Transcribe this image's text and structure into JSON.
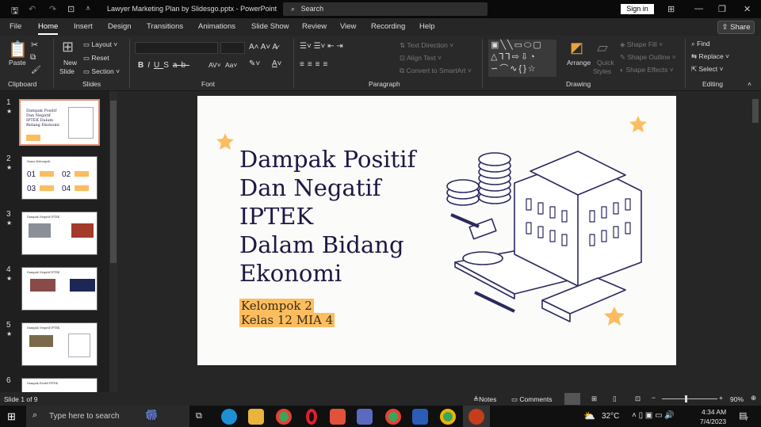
{
  "window": {
    "title": "Lawyer Marketing Plan by Slidesgo.pptx  -  PowerPoint",
    "search": "Search",
    "sign_in": "Sign in"
  },
  "tabs": [
    "File",
    "Home",
    "Insert",
    "Design",
    "Transitions",
    "Animations",
    "Slide Show",
    "Review",
    "View",
    "Recording",
    "Help"
  ],
  "share": "Share",
  "ribbon": {
    "clipboard": {
      "label": "Clipboard",
      "paste": "Paste"
    },
    "slides": {
      "label": "Slides",
      "new_slide_1": "New",
      "new_slide_2": "Slide",
      "layout": "Layout",
      "reset": "Reset",
      "section": "Section"
    },
    "font": {
      "label": "Font"
    },
    "paragraph": {
      "label": "Paragraph",
      "text_direction": "Text Direction",
      "align_text": "Align Text",
      "convert": "Convert to SmartArt"
    },
    "drawing": {
      "label": "Drawing",
      "arrange": "Arrange",
      "quick_styles_1": "Quick",
      "quick_styles_2": "Styles",
      "shape_fill": "Shape Fill",
      "shape_outline": "Shape Outline",
      "shape_effects": "Shape Effects"
    },
    "editing": {
      "label": "Editing",
      "find": "Find",
      "replace": "Replace",
      "select": "Select"
    }
  },
  "thumbnails": [
    {
      "num": "1",
      "title": "Dampak Positif Dan Negatif IPTEK Dalam Bidang Ekonomi"
    },
    {
      "num": "2",
      "title": "Nama Kelompok"
    },
    {
      "num": "3",
      "title": "Dampak Negatif IPTEK"
    },
    {
      "num": "4",
      "title": "Dampak Negatif IPTEK"
    },
    {
      "num": "5",
      "title": "Dampak Negatif IPTEK"
    },
    {
      "num": "6",
      "title": "Dampak Positif IPTEK"
    }
  ],
  "slide2_nums": [
    "01",
    "02",
    "03",
    "04"
  ],
  "slide": {
    "title": "Dampak Positif\nDan Negatif\nIPTEK\nDalam Bidang\nEkonomi",
    "subtitle1": "Kelompok 2",
    "subtitle2": "Kelas 12 MIA 4"
  },
  "status": {
    "slide_info": "Slide 1 of 9",
    "notes": "Notes",
    "comments": "Comments",
    "zoom": "90%"
  },
  "taskbar": {
    "search": "Type here to search",
    "temp": "32°C",
    "time": "4:34 AM",
    "date": "7/4/2023",
    "notif": "7"
  },
  "colors": {
    "accent": "#fbbd5f",
    "title": "#1c1845",
    "ppt": "#c43e1c"
  }
}
